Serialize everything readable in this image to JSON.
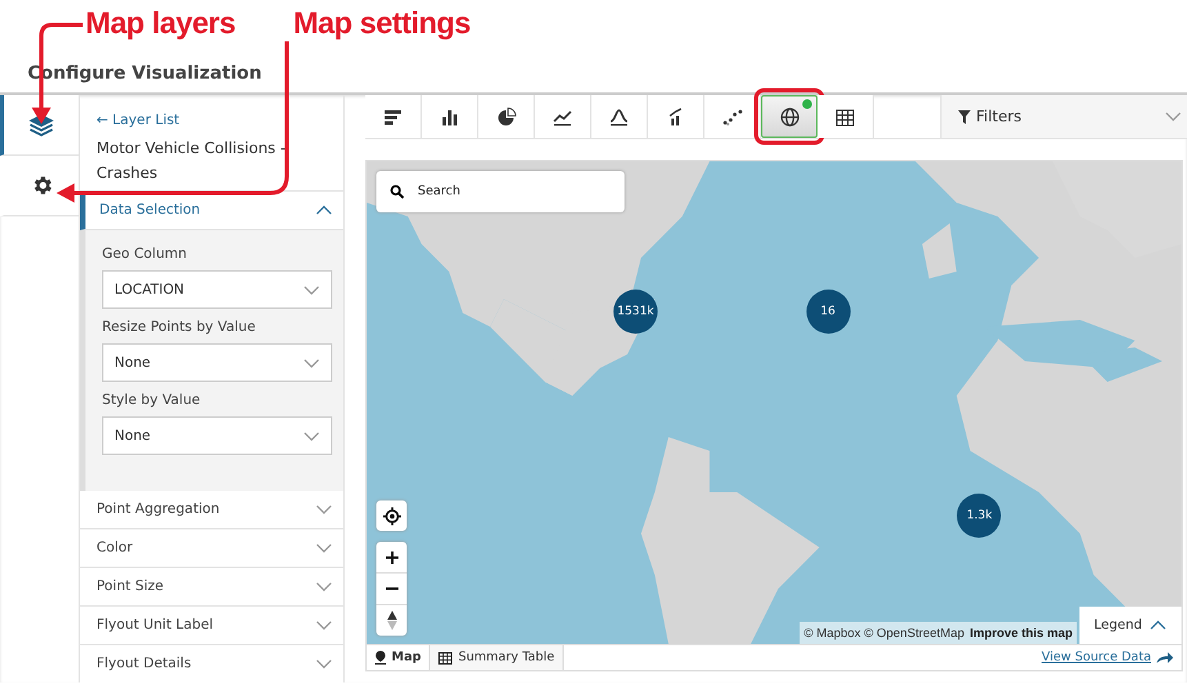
{
  "annotations": [
    {
      "text": "Map layers"
    },
    {
      "text": "Map settings"
    }
  ],
  "title": "Configure Visualization",
  "rail": [
    {
      "kind": "layers",
      "selected": true
    },
    {
      "kind": "settings",
      "selected": false
    }
  ],
  "panel": {
    "back_link": "← Layer List",
    "layer_title": "Motor Vehicle Collisions - Crashes",
    "sections": [
      {
        "label": "Data Selection",
        "expanded": true,
        "fields": [
          {
            "label": "Geo Column",
            "value": "LOCATION"
          },
          {
            "label": "Resize Points by Value",
            "value": "None"
          },
          {
            "label": "Style by Value",
            "value": "None"
          }
        ]
      },
      {
        "label": "Point Aggregation",
        "expanded": false
      },
      {
        "label": "Color",
        "expanded": false
      },
      {
        "label": "Point Size",
        "expanded": false
      },
      {
        "label": "Flyout Unit Label",
        "expanded": false
      },
      {
        "label": "Flyout Details",
        "expanded": false
      }
    ]
  },
  "chart_types": [
    {
      "kind": "bar-horizontal",
      "selected": false,
      "highlighted": false
    },
    {
      "kind": "column",
      "selected": false,
      "highlighted": false
    },
    {
      "kind": "pie",
      "selected": false,
      "highlighted": false
    },
    {
      "kind": "line",
      "selected": false,
      "highlighted": false
    },
    {
      "kind": "histogram",
      "selected": false,
      "highlighted": false
    },
    {
      "kind": "combo",
      "selected": false,
      "highlighted": false
    },
    {
      "kind": "scatter",
      "selected": false,
      "highlighted": false
    },
    {
      "kind": "map",
      "selected": true,
      "highlighted": true
    },
    {
      "kind": "table",
      "selected": false,
      "highlighted": false
    }
  ],
  "filters": {
    "label": "Filters"
  },
  "map": {
    "kind": "picture",
    "search": {
      "placeholder": "Search"
    },
    "clusters": [
      {
        "label": "1531k"
      },
      {
        "label": "16"
      },
      {
        "label": "1.3k"
      }
    ],
    "attribution": "© Mapbox © OpenStreetMap",
    "improve_link": "Improve this map",
    "legend": {
      "label": "Legend",
      "expanded": true
    }
  },
  "bottom_tabs": [
    {
      "label": "Map",
      "kind": "map",
      "selected": true
    },
    {
      "label": "Summary Table",
      "kind": "table",
      "selected": false
    }
  ],
  "view_source": "View Source Data"
}
